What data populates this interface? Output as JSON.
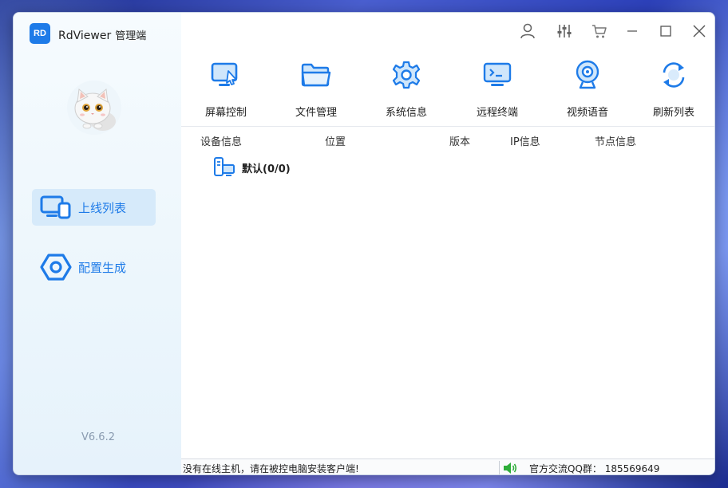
{
  "app": {
    "logo_text": "RD",
    "title": "RdViewer",
    "subtitle": "管理端",
    "version": "V6.6.2"
  },
  "sidebar": {
    "items": [
      {
        "label": "上线列表",
        "icon": "monitor-devices-icon",
        "active": true
      },
      {
        "label": "配置生成",
        "icon": "hex-nut-icon",
        "active": false
      }
    ]
  },
  "titlebar": {
    "icons": [
      "user-icon",
      "sliders-icon",
      "cart-icon",
      "minimize-icon",
      "maximize-icon",
      "close-icon"
    ]
  },
  "toolbar": {
    "items": [
      {
        "label": "屏幕控制",
        "icon": "screen-control-icon"
      },
      {
        "label": "文件管理",
        "icon": "folder-icon"
      },
      {
        "label": "系统信息",
        "icon": "gear-icon"
      },
      {
        "label": "远程终端",
        "icon": "terminal-icon"
      },
      {
        "label": "视频语音",
        "icon": "webcam-icon"
      },
      {
        "label": "刷新列表",
        "icon": "refresh-icon"
      }
    ]
  },
  "table": {
    "columns": [
      "设备信息",
      "位置",
      "版本",
      "IP信息",
      "节点信息"
    ],
    "groups": [
      {
        "label": "默认(0/0)",
        "icon": "device-group-icon"
      }
    ]
  },
  "status": {
    "message": "没有在线主机，请在被控电脑安装客户端!",
    "qq_group": "官方交流QQ群： 185569649"
  },
  "colors": {
    "accent": "#1e7be8",
    "sidebar_active_bg": "#d6eafa",
    "speaker_green": "#2fae3a"
  }
}
